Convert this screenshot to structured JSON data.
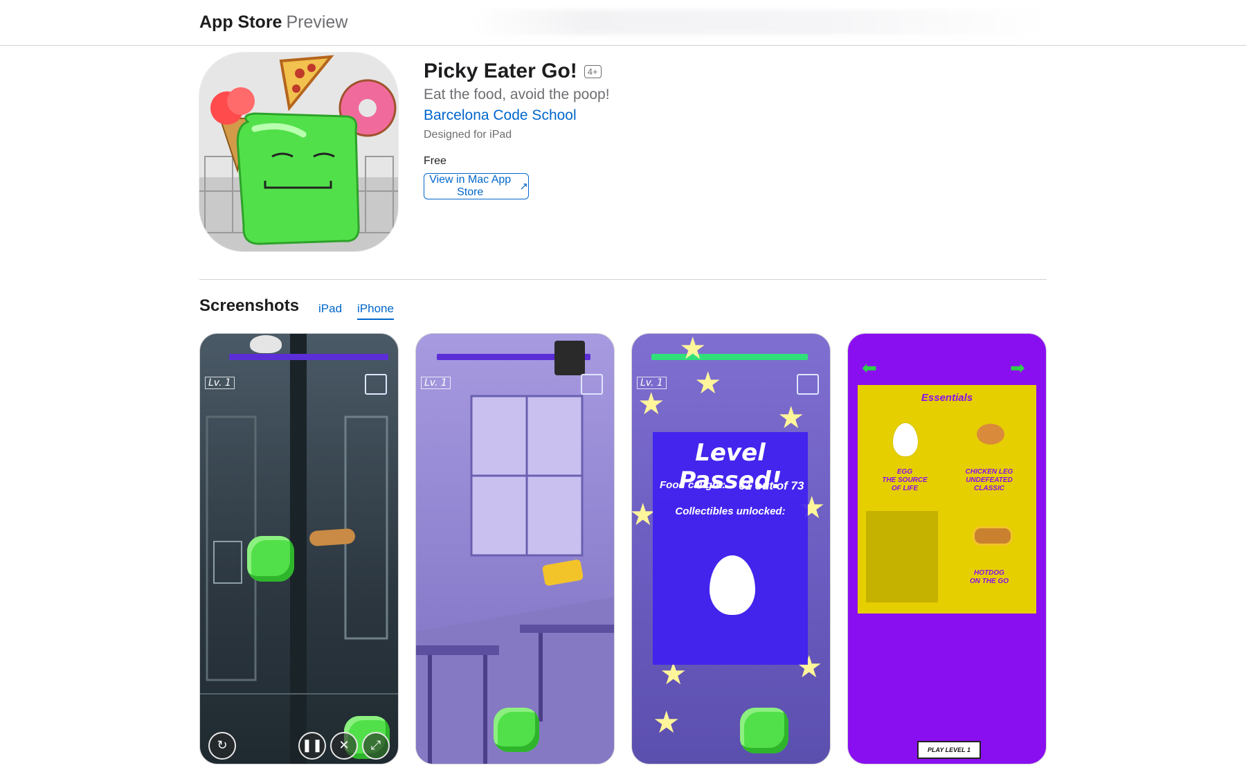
{
  "header": {
    "brand_bold": "App Store",
    "brand_light": "Preview"
  },
  "app": {
    "title": "Picky Eater Go!",
    "age_rating": "4+",
    "subtitle": "Eat the food, avoid the poop!",
    "developer": "Barcelona Code School",
    "designed_for": "Designed for iPad",
    "price": "Free",
    "mac_store_button": "View in Mac App Store",
    "mac_store_arrow": "↗"
  },
  "screenshots": {
    "heading": "Screenshots",
    "tabs": [
      {
        "label": "iPad"
      },
      {
        "label": "iPhone"
      }
    ],
    "active_tab": "iPhone",
    "shot1": {
      "level": "Lv. 1"
    },
    "shot2": {
      "level": "Lv. 1"
    },
    "shot3": {
      "level": "Lv. 1",
      "banner_title": "Level Passed!",
      "food_label": "Food caught:",
      "food_value": "61 out of 73",
      "collectibles": "Collectibles unlocked:"
    },
    "shot4": {
      "heading": "Essentials",
      "items": [
        {
          "lines": [
            "EGG",
            "THE SOURCE",
            "OF LIFE"
          ]
        },
        {
          "lines": [
            "CHICKEN LEG",
            "UNDEFEATED",
            "CLASSIC"
          ]
        },
        {
          "lines": [
            "HOTDOG",
            "ON THE GO"
          ]
        }
      ],
      "play_button": "PLAY LEVEL 1"
    }
  },
  "colors": {
    "accent": "#0066cc",
    "slime_green": "#52e04a",
    "purple": "#8a0ff0",
    "mustard": "#e6cf00"
  }
}
